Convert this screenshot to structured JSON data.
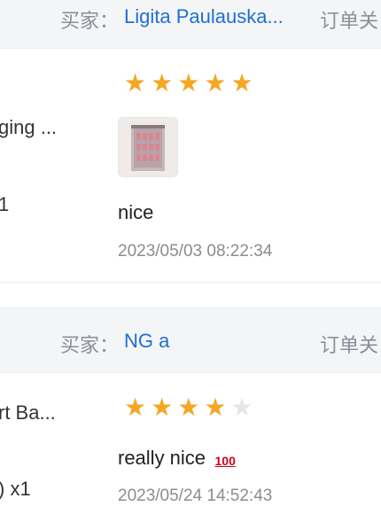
{
  "reviews": [
    {
      "buyer_label": "买家：",
      "buyer_name": "Ligita Paulauska...",
      "order_label": "订单关",
      "product": "ging ...",
      "qty": "1",
      "rating": 5,
      "has_photo": true,
      "comment": "nice",
      "badge": "",
      "timestamp": "2023/05/03 08:22:34"
    },
    {
      "buyer_label": "买家：",
      "buyer_name": "NG a",
      "order_label": "订单关",
      "product": "rt Ba...",
      "qty": ") x1",
      "rating": 4,
      "has_photo": false,
      "comment": "really nice",
      "badge": "100",
      "timestamp": "2023/05/24 14:52:43"
    }
  ],
  "colors": {
    "star_on": "#f5a623",
    "star_off": "#e6e6e6",
    "buyer_name": "#1f6fd1"
  },
  "icons": {
    "star": "star-icon",
    "hundred": "hundred-points-icon"
  }
}
